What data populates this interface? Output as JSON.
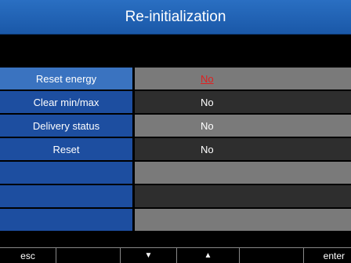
{
  "header": {
    "title": "Re-initialization"
  },
  "menu": {
    "items": [
      {
        "label": "Reset energy",
        "value": "No"
      },
      {
        "label": "Clear min/max",
        "value": "No"
      },
      {
        "label": "Delivery status",
        "value": "No"
      },
      {
        "label": "Reset",
        "value": "No"
      },
      {
        "label": "",
        "value": ""
      },
      {
        "label": "",
        "value": ""
      },
      {
        "label": "",
        "value": ""
      }
    ]
  },
  "softkeys": {
    "esc": "esc",
    "blank1": "",
    "down_icon": "▼",
    "up_icon": "▲",
    "blank2": "",
    "enter": "enter"
  },
  "colors": {
    "title_bg": "#1a58a8",
    "label_bg": "#1d4ea0",
    "selected_label_bg": "#3a73c0",
    "selected_value_text": "#e02020"
  }
}
